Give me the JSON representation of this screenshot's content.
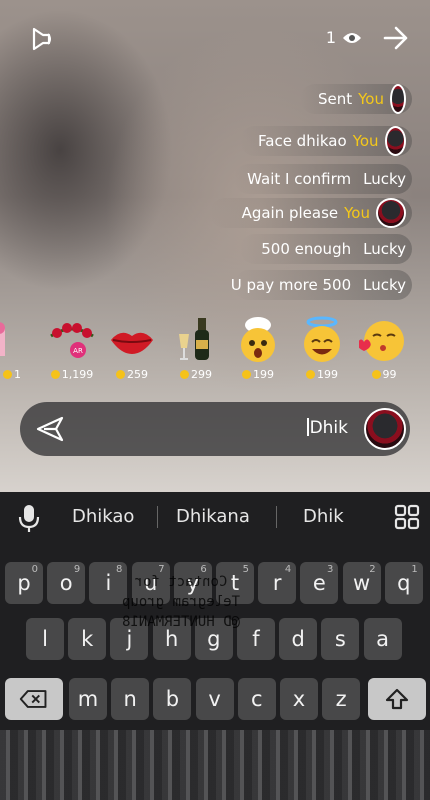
{
  "viewer_count": "1",
  "messages": [
    {
      "type": "you",
      "name": "You",
      "text": "Sent"
    },
    {
      "type": "you",
      "name": "You",
      "text": "Face dhikao"
    },
    {
      "type": "plain",
      "name": "Lucky",
      "text": "Wait I confirm"
    },
    {
      "type": "you",
      "name": "You",
      "text": "Again please"
    },
    {
      "type": "plain",
      "name": "Lucky",
      "text": "500 enough"
    },
    {
      "type": "plain",
      "name": "Lucky",
      "text": "U pay more 500"
    }
  ],
  "gifts": [
    {
      "icon": "kiss-emoji-icon",
      "price": "99"
    },
    {
      "icon": "halo-emoji-icon",
      "price": "199"
    },
    {
      "icon": "chef-emoji-icon",
      "price": "199"
    },
    {
      "icon": "champagne-icon",
      "price": "299"
    },
    {
      "icon": "lips-icon",
      "price": "259"
    },
    {
      "icon": "rose-crown-icon",
      "price": "1,199"
    },
    {
      "icon": "flower-icon",
      "price": "1"
    }
  ],
  "input": {
    "text": "Dhik"
  },
  "suggestions": [
    "Dhik",
    "Dhikana",
    "Dhikao"
  ],
  "keyboard": {
    "row1": [
      {
        "k": "p",
        "n": "0"
      },
      {
        "k": "o",
        "n": "9"
      },
      {
        "k": "i",
        "n": "8"
      },
      {
        "k": "u",
        "n": "7"
      },
      {
        "k": "y",
        "n": "6"
      },
      {
        "k": "t",
        "n": "5"
      },
      {
        "k": "r",
        "n": "4"
      },
      {
        "k": "e",
        "n": "3"
      },
      {
        "k": "w",
        "n": "2"
      },
      {
        "k": "q",
        "n": "1"
      }
    ],
    "row2": [
      "l",
      "k",
      "j",
      "h",
      "g",
      "f",
      "d",
      "s",
      "a"
    ],
    "row3": [
      "m",
      "n",
      "b",
      "v",
      "c",
      "x",
      "z"
    ]
  },
  "watermark": [
    "Contact for",
    "Telegram group",
    "@D HUNTERMAN18"
  ],
  "colors": {
    "name_accent": "#f4c81a",
    "coin": "#f5c21a"
  }
}
